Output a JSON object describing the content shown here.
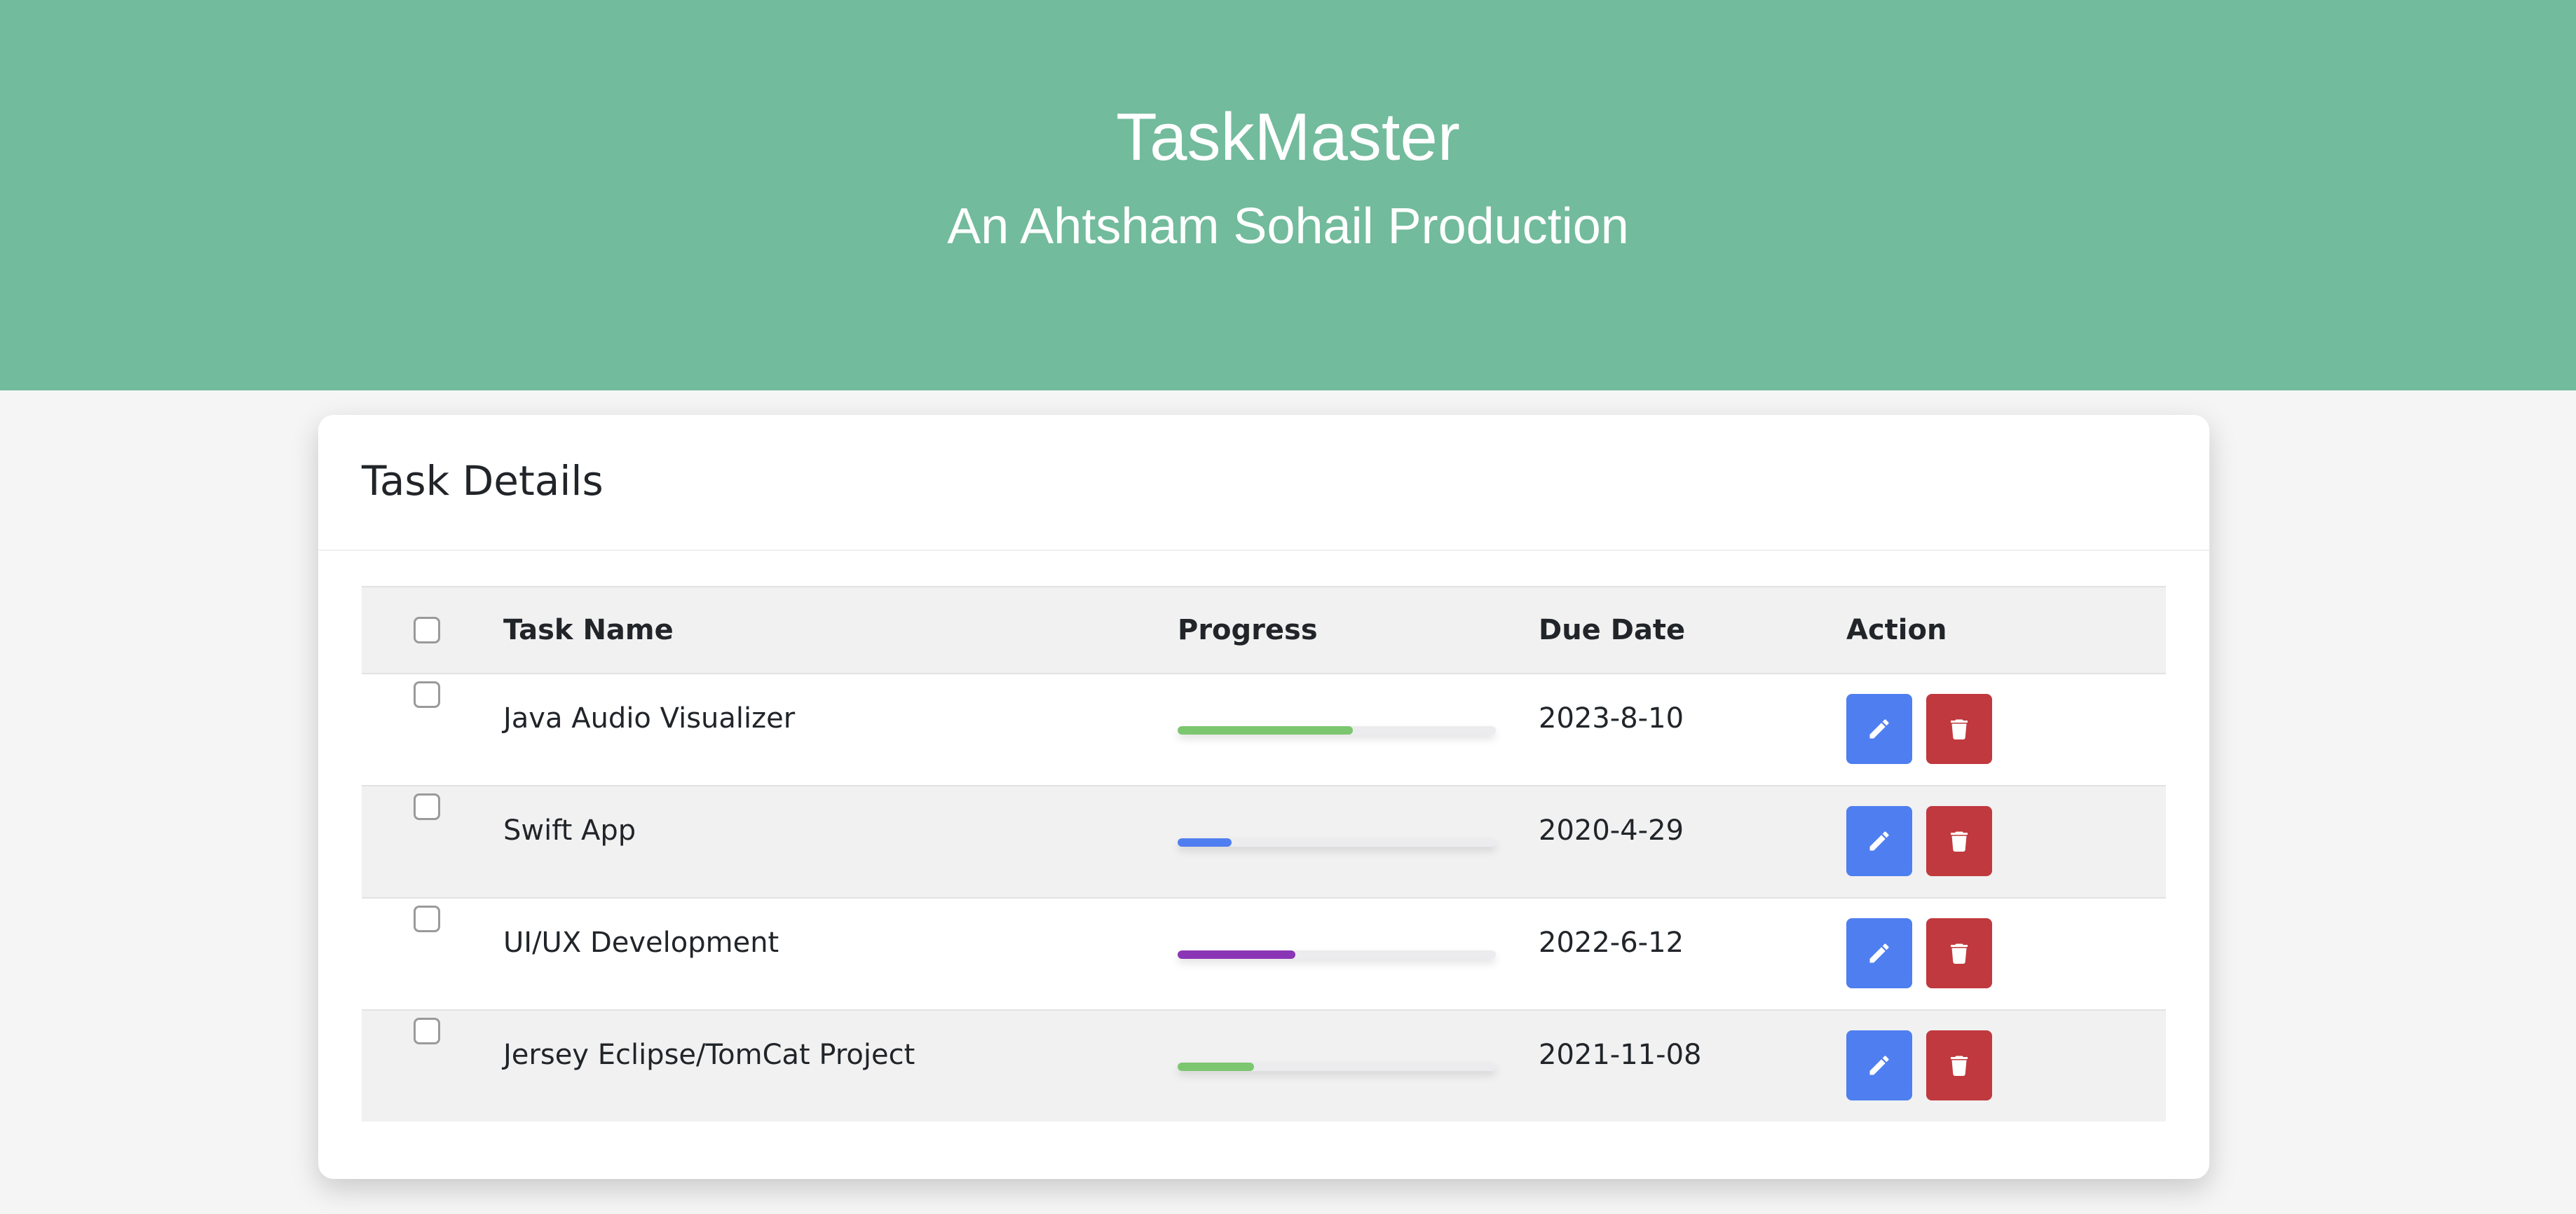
{
  "header": {
    "title": "TaskMaster",
    "subtitle": "An Ahtsham Sohail Production"
  },
  "card": {
    "title": "Task Details"
  },
  "table": {
    "columns": {
      "name": "Task Name",
      "progress": "Progress",
      "due_date": "Due Date",
      "action": "Action"
    },
    "rows": [
      {
        "name": "Java Audio Visualizer",
        "progress": 0.55,
        "progress_color": "#7cc66f",
        "due_date": "2023-8-10"
      },
      {
        "name": "Swift App",
        "progress": 0.17,
        "progress_color": "#4f7ef0",
        "due_date": "2020-4-29"
      },
      {
        "name": "UI/UX Development",
        "progress": 0.37,
        "progress_color": "#8a35b5",
        "due_date": "2022-6-12"
      },
      {
        "name": "Jersey Eclipse/TomCat Project",
        "progress": 0.24,
        "progress_color": "#7cc66f",
        "due_date": "2021-11-08"
      }
    ]
  },
  "icons": {
    "edit": "pencil-icon",
    "delete": "trash-icon"
  },
  "colors": {
    "header_bg": "#72bb9c",
    "edit_button": "#4f7ef0",
    "delete_button": "#c0393e"
  }
}
